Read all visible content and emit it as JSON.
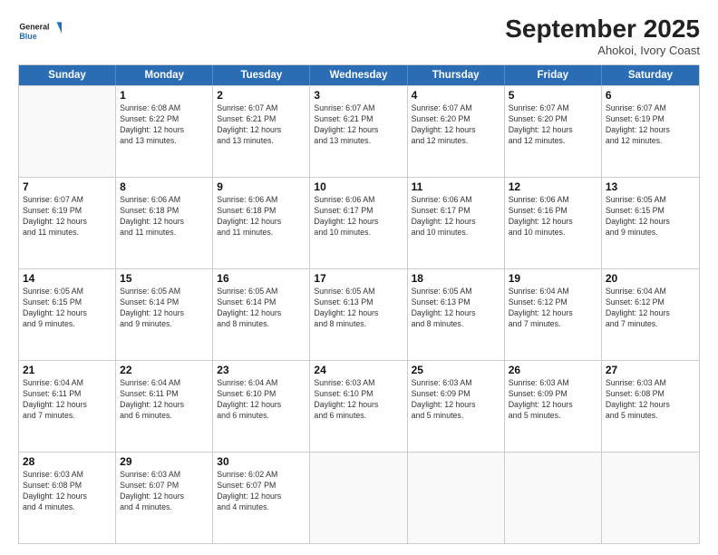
{
  "logo": {
    "line1": "General",
    "line2": "Blue"
  },
  "title": "September 2025",
  "subtitle": "Ahokoi, Ivory Coast",
  "header": {
    "days": [
      "Sunday",
      "Monday",
      "Tuesday",
      "Wednesday",
      "Thursday",
      "Friday",
      "Saturday"
    ]
  },
  "weeks": [
    [
      {
        "day": "",
        "info": ""
      },
      {
        "day": "1",
        "info": "Sunrise: 6:08 AM\nSunset: 6:22 PM\nDaylight: 12 hours\nand 13 minutes."
      },
      {
        "day": "2",
        "info": "Sunrise: 6:07 AM\nSunset: 6:21 PM\nDaylight: 12 hours\nand 13 minutes."
      },
      {
        "day": "3",
        "info": "Sunrise: 6:07 AM\nSunset: 6:21 PM\nDaylight: 12 hours\nand 13 minutes."
      },
      {
        "day": "4",
        "info": "Sunrise: 6:07 AM\nSunset: 6:20 PM\nDaylight: 12 hours\nand 12 minutes."
      },
      {
        "day": "5",
        "info": "Sunrise: 6:07 AM\nSunset: 6:20 PM\nDaylight: 12 hours\nand 12 minutes."
      },
      {
        "day": "6",
        "info": "Sunrise: 6:07 AM\nSunset: 6:19 PM\nDaylight: 12 hours\nand 12 minutes."
      }
    ],
    [
      {
        "day": "7",
        "info": "Sunrise: 6:07 AM\nSunset: 6:19 PM\nDaylight: 12 hours\nand 11 minutes."
      },
      {
        "day": "8",
        "info": "Sunrise: 6:06 AM\nSunset: 6:18 PM\nDaylight: 12 hours\nand 11 minutes."
      },
      {
        "day": "9",
        "info": "Sunrise: 6:06 AM\nSunset: 6:18 PM\nDaylight: 12 hours\nand 11 minutes."
      },
      {
        "day": "10",
        "info": "Sunrise: 6:06 AM\nSunset: 6:17 PM\nDaylight: 12 hours\nand 10 minutes."
      },
      {
        "day": "11",
        "info": "Sunrise: 6:06 AM\nSunset: 6:17 PM\nDaylight: 12 hours\nand 10 minutes."
      },
      {
        "day": "12",
        "info": "Sunrise: 6:06 AM\nSunset: 6:16 PM\nDaylight: 12 hours\nand 10 minutes."
      },
      {
        "day": "13",
        "info": "Sunrise: 6:05 AM\nSunset: 6:15 PM\nDaylight: 12 hours\nand 9 minutes."
      }
    ],
    [
      {
        "day": "14",
        "info": "Sunrise: 6:05 AM\nSunset: 6:15 PM\nDaylight: 12 hours\nand 9 minutes."
      },
      {
        "day": "15",
        "info": "Sunrise: 6:05 AM\nSunset: 6:14 PM\nDaylight: 12 hours\nand 9 minutes."
      },
      {
        "day": "16",
        "info": "Sunrise: 6:05 AM\nSunset: 6:14 PM\nDaylight: 12 hours\nand 8 minutes."
      },
      {
        "day": "17",
        "info": "Sunrise: 6:05 AM\nSunset: 6:13 PM\nDaylight: 12 hours\nand 8 minutes."
      },
      {
        "day": "18",
        "info": "Sunrise: 6:05 AM\nSunset: 6:13 PM\nDaylight: 12 hours\nand 8 minutes."
      },
      {
        "day": "19",
        "info": "Sunrise: 6:04 AM\nSunset: 6:12 PM\nDaylight: 12 hours\nand 7 minutes."
      },
      {
        "day": "20",
        "info": "Sunrise: 6:04 AM\nSunset: 6:12 PM\nDaylight: 12 hours\nand 7 minutes."
      }
    ],
    [
      {
        "day": "21",
        "info": "Sunrise: 6:04 AM\nSunset: 6:11 PM\nDaylight: 12 hours\nand 7 minutes."
      },
      {
        "day": "22",
        "info": "Sunrise: 6:04 AM\nSunset: 6:11 PM\nDaylight: 12 hours\nand 6 minutes."
      },
      {
        "day": "23",
        "info": "Sunrise: 6:04 AM\nSunset: 6:10 PM\nDaylight: 12 hours\nand 6 minutes."
      },
      {
        "day": "24",
        "info": "Sunrise: 6:03 AM\nSunset: 6:10 PM\nDaylight: 12 hours\nand 6 minutes."
      },
      {
        "day": "25",
        "info": "Sunrise: 6:03 AM\nSunset: 6:09 PM\nDaylight: 12 hours\nand 5 minutes."
      },
      {
        "day": "26",
        "info": "Sunrise: 6:03 AM\nSunset: 6:09 PM\nDaylight: 12 hours\nand 5 minutes."
      },
      {
        "day": "27",
        "info": "Sunrise: 6:03 AM\nSunset: 6:08 PM\nDaylight: 12 hours\nand 5 minutes."
      }
    ],
    [
      {
        "day": "28",
        "info": "Sunrise: 6:03 AM\nSunset: 6:08 PM\nDaylight: 12 hours\nand 4 minutes."
      },
      {
        "day": "29",
        "info": "Sunrise: 6:03 AM\nSunset: 6:07 PM\nDaylight: 12 hours\nand 4 minutes."
      },
      {
        "day": "30",
        "info": "Sunrise: 6:02 AM\nSunset: 6:07 PM\nDaylight: 12 hours\nand 4 minutes."
      },
      {
        "day": "",
        "info": ""
      },
      {
        "day": "",
        "info": ""
      },
      {
        "day": "",
        "info": ""
      },
      {
        "day": "",
        "info": ""
      }
    ]
  ]
}
